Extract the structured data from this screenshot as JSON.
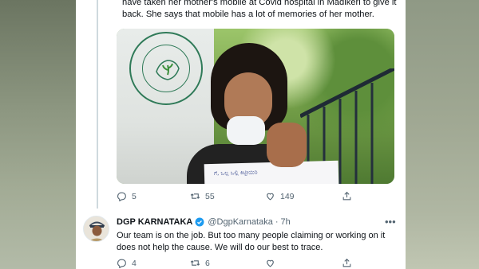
{
  "tweet1": {
    "text": "have taken her mother's mobile at Covid hospital in Madikeri to give it back. She says that mobile has a lot of memories of her mother.",
    "actions": {
      "replies": "5",
      "retweets": "55",
      "likes": "149"
    },
    "photo_paper_text": "ಗೆ, ಒಲ್ಲ ಒಲ್ಲಿ ಕಿಟ್ಟೀಯಿರಿ"
  },
  "tweet2": {
    "name": "DGP KARNATAKA",
    "handle": "@DgpKarnataka",
    "time": "7h",
    "text": "Our team is on the job. But too many people claiming or working on it does not help the cause. We will do our best to trace.",
    "actions": {
      "replies": "4",
      "retweets": "6"
    }
  },
  "icons": [
    "reply-icon",
    "retweet-icon",
    "like-icon",
    "share-icon",
    "verified-badge-icon",
    "more-icon"
  ],
  "colors": {
    "text": "#0f1419",
    "muted": "#536471",
    "verified": "#1d9bf0",
    "thread_line": "#cfd9de"
  }
}
